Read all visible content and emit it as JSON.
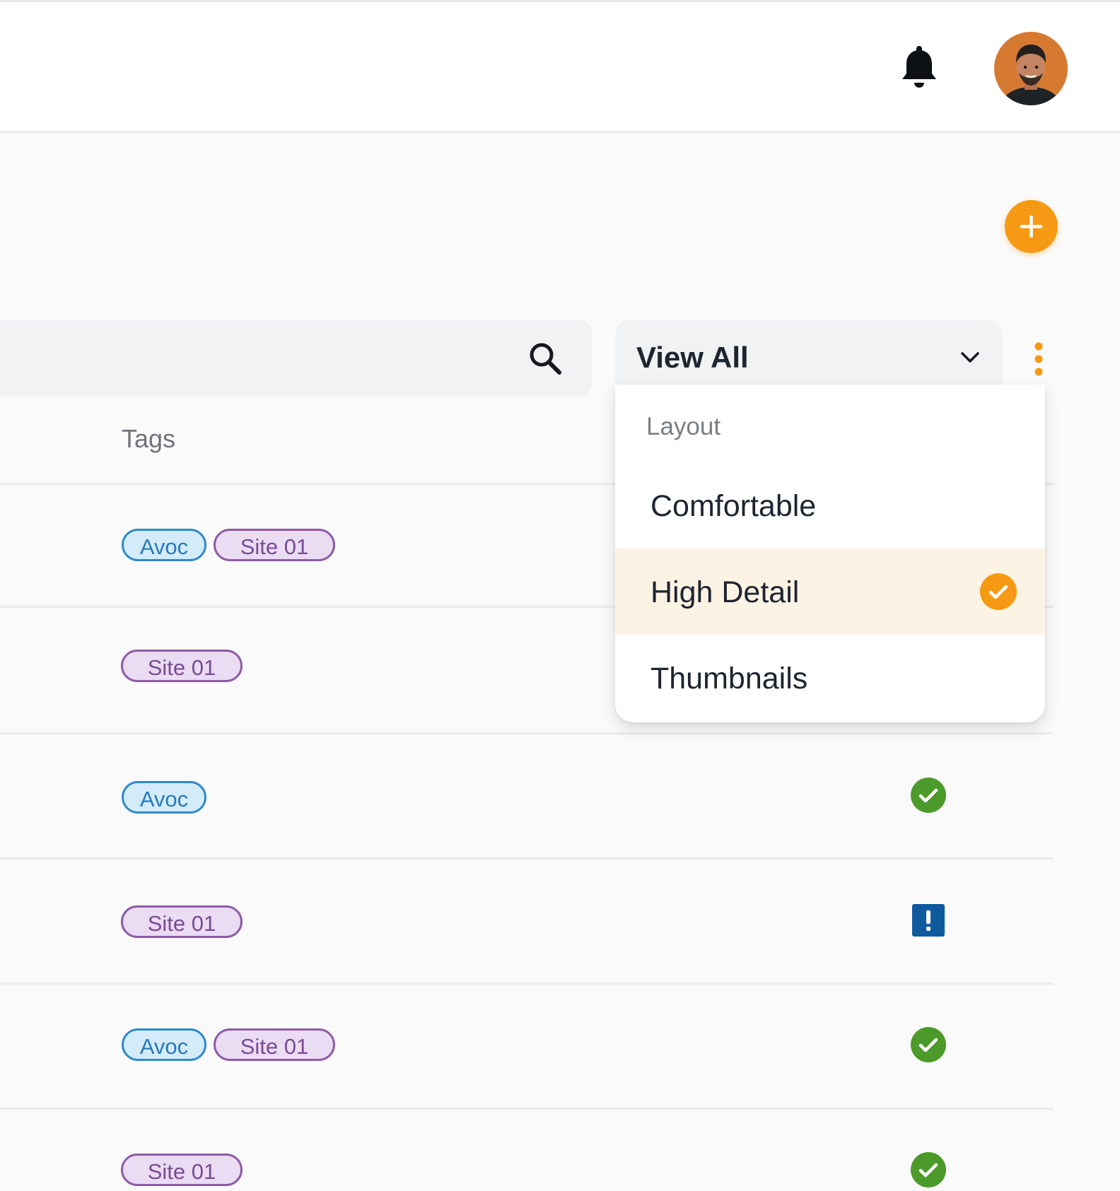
{
  "header": {
    "notifications_icon": "bell-icon",
    "avatar_icon": "user-avatar"
  },
  "add_button": {
    "icon": "plus-icon",
    "color": "#f59a12"
  },
  "search": {
    "value": "",
    "placeholder": "",
    "icon": "search-icon"
  },
  "view_filter": {
    "selected": "View All",
    "icon": "chevron-down-icon"
  },
  "more_options": {
    "icon": "kebab-vertical-icon",
    "color": "#f59a12"
  },
  "table": {
    "columns": [
      "Tags"
    ],
    "rows": [
      {
        "tags": [
          "Avoc",
          "Site 01"
        ],
        "status": null
      },
      {
        "tags": [
          "Site 01"
        ],
        "status": null
      },
      {
        "tags": [
          "Avoc"
        ],
        "status": "success"
      },
      {
        "tags": [
          "Site 01"
        ],
        "status": "alert"
      },
      {
        "tags": [
          "Avoc",
          "Site 01"
        ],
        "status": "success"
      },
      {
        "tags": [
          "Site 01"
        ],
        "status": "success"
      }
    ]
  },
  "layout_menu": {
    "heading": "Layout",
    "items": [
      {
        "label": "Comfortable",
        "selected": false
      },
      {
        "label": "High Detail",
        "selected": true
      },
      {
        "label": "Thumbnails",
        "selected": false
      }
    ],
    "selected_color": "#f59a12"
  },
  "colors": {
    "success": "#4c9a2a",
    "alert": "#0f5a9c",
    "tag_avoc": "#2f8ac8",
    "tag_site": "#8e5ba6"
  }
}
